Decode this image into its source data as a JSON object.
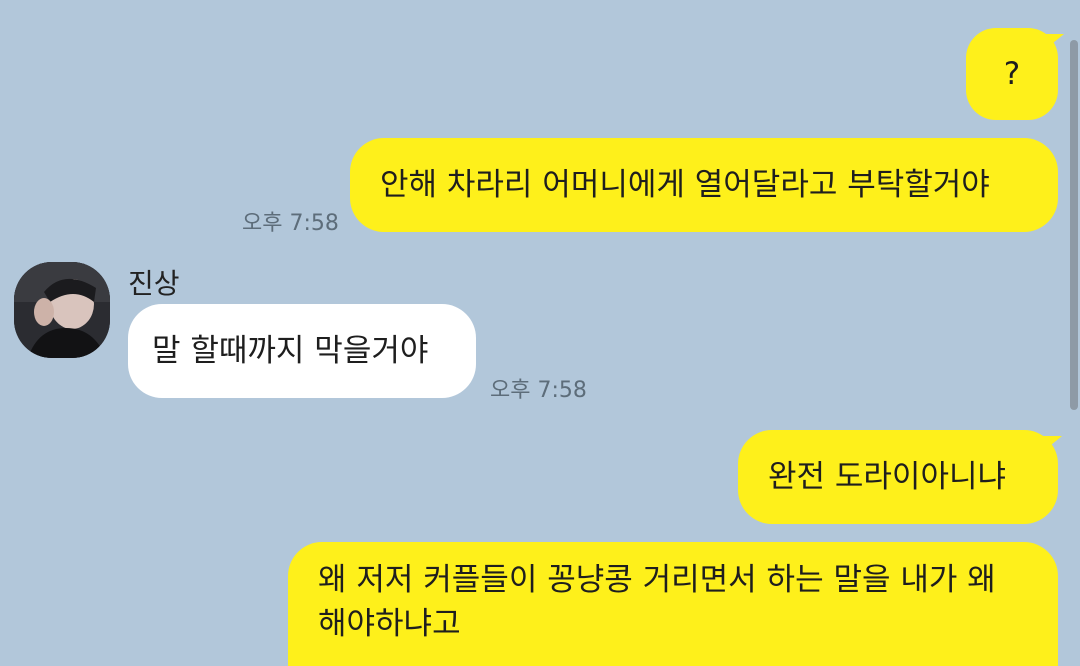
{
  "chat": {
    "messages": [
      {
        "sender": "me",
        "text": "?"
      },
      {
        "sender": "me",
        "text": "안해 차라리 어머니에게 열어달라고 부탁할거야",
        "time": "오후 7:58"
      },
      {
        "sender": "them",
        "name": "진상",
        "text": "말 할때까지 막을거야",
        "time": "오후 7:58"
      },
      {
        "sender": "me",
        "text": "완전 도라이아니냐"
      },
      {
        "sender": "me",
        "text_line1": "왜 저저 커플들이 꽁냥콩 거리면서 하는 말을 내가 왜",
        "text_line2": "해야하냐고"
      }
    ]
  },
  "colors": {
    "background": "#b2c7da",
    "my_bubble": "#fef01b",
    "their_bubble": "#ffffff",
    "timestamp": "#5d6d7a"
  },
  "icons": {
    "avatar": "profile-photo"
  }
}
